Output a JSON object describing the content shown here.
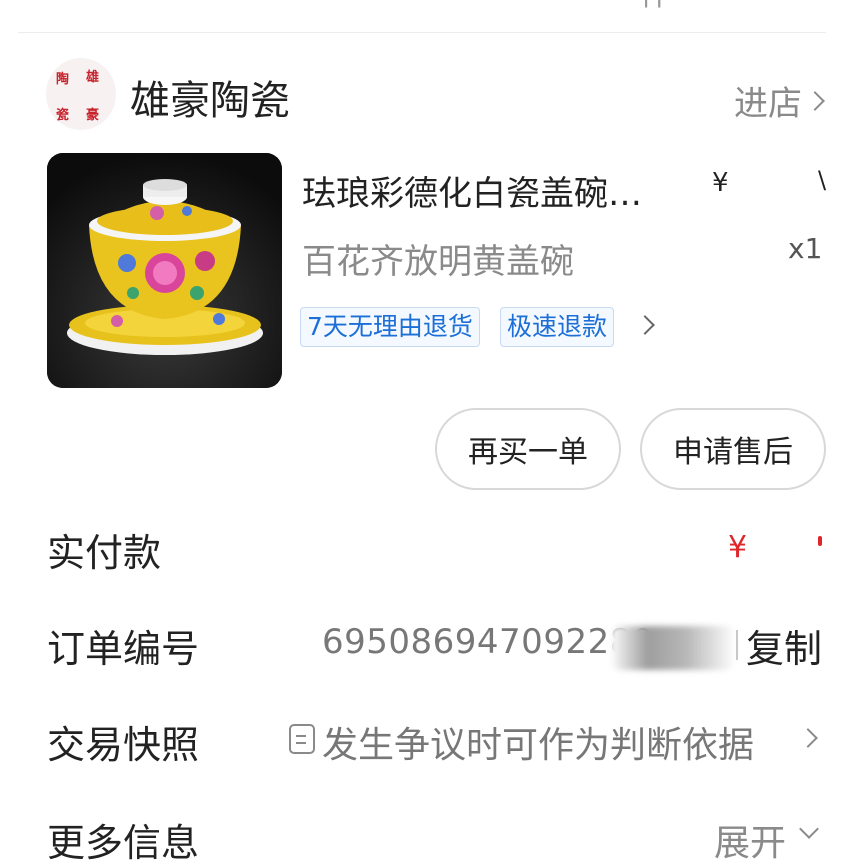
{
  "top": {
    "fragment": "件"
  },
  "shop": {
    "logo_chars": [
      "陶",
      "雄",
      "瓷",
      "豪"
    ],
    "name": "雄豪陶瓷",
    "enter_label": "进店"
  },
  "product": {
    "title": "珐琅彩德化白瓷盖碗…",
    "spec": "百花齐放明黄盖碗",
    "price_fragment": "¥",
    "tick_fragment": "\\",
    "quantity_fragment": "x1",
    "tags": [
      "7天无理由退货",
      "极速退款"
    ]
  },
  "actions": {
    "rebuy": "再买一单",
    "after_sale": "申请售后"
  },
  "info": {
    "paid_label": "实付款",
    "paid_value": "¥",
    "order_label": "订单编号",
    "order_number": "695086947092280",
    "copy_label": "复制",
    "snapshot_label": "交易快照",
    "snapshot_text": "发生争议时可作为判断依据",
    "more_label": "更多信息",
    "expand_label": "展开"
  },
  "colors": {
    "accent_red": "#e0262b",
    "tag_blue": "#1c6fd6",
    "muted_text": "#8a8a8a"
  }
}
